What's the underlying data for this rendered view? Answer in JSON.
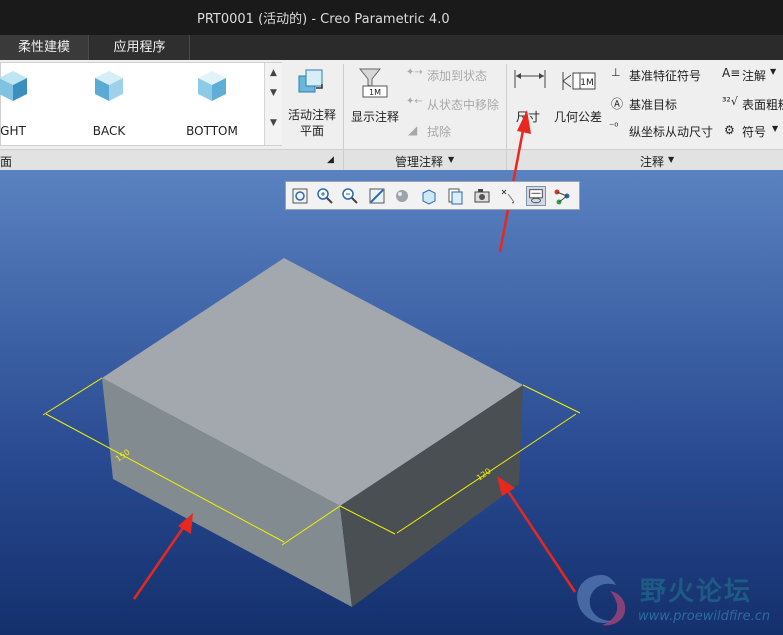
{
  "window": {
    "title": "PRT0001 (活动的) - Creo Parametric 4.0"
  },
  "tabs": [
    {
      "label": "柔性建模"
    },
    {
      "label": "应用程序"
    }
  ],
  "ribbon": {
    "views": [
      {
        "label": "GHT",
        "icon": "cube-view-icon"
      },
      {
        "label": "BACK",
        "icon": "cube-view-icon"
      },
      {
        "label": "BOTTOM",
        "icon": "cube-view-icon"
      }
    ],
    "active_annotation_plane": "活动注释\n平面",
    "show_annotations": "显示注释",
    "add_to_state": "添加到状态",
    "remove_from_state": "从状态中移除",
    "erase": "拭除",
    "dimension": "尺寸",
    "geometric_tolerance": "几何公差",
    "datum_feature_symbol": "基准特征符号",
    "datum_target": "基准目标",
    "ordinate_dimension": "纵坐标从动尺寸",
    "note": "注解",
    "surface_finish": "表面粗糙",
    "symbol": "符号",
    "group_view_label": "面",
    "group_manage_label": "管理注释",
    "group_annotation_label": "注释",
    "dim_text_left": "150",
    "dim_text_right": "120"
  },
  "watermark": {
    "title": "野火论坛",
    "url": "www.proewildfire.cn"
  },
  "colors": {
    "accent_arrow": "#e8281f",
    "dimension": "#f2f200",
    "model_top": "#a2a8ad",
    "model_front": "#818b90",
    "model_side": "#4a4f53"
  }
}
